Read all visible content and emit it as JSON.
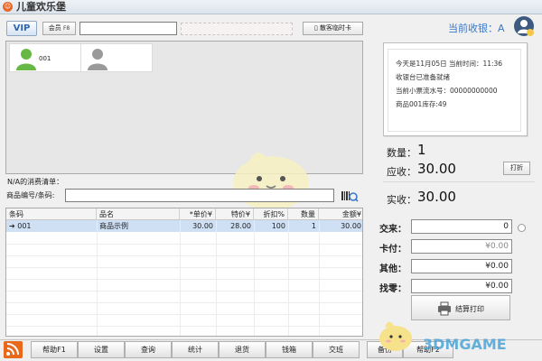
{
  "window": {
    "title": "儿童欢乐堡"
  },
  "toolbar": {
    "vip_label": "VIP",
    "member_label": "会员",
    "member_key": "F8",
    "member_input_value": "",
    "temp_card_label": "散客临时卡"
  },
  "cashier_panel": {
    "tiles": [
      {
        "label": "001"
      },
      {
        "label": ""
      }
    ]
  },
  "list": {
    "title": "N/A的消费清单：",
    "code_label": "商品编号/条码:",
    "code_value": "",
    "columns": [
      "条码",
      "品名",
      "*单价¥",
      "特价¥",
      "折扣%",
      "数量",
      "金额¥"
    ],
    "rows": [
      {
        "code": "001",
        "name": "商品示例",
        "price": "30.00",
        "special": "28.00",
        "discount": "100",
        "qty": "1",
        "amount": "30.00"
      }
    ]
  },
  "bottom_nav": [
    "帮助F1",
    "设置",
    "查询",
    "统计",
    "退货",
    "钱箱",
    "交班",
    "备份",
    "帮助F2"
  ],
  "right": {
    "cashier": "当前收银：A",
    "ticket_lines": [
      "今天是11月05日 当前时间：11:36",
      "收银台已准备就绪",
      "当前小票流水号：00000000000",
      "商品001库存:49"
    ],
    "qty_label": "数量：",
    "qty_value": "1",
    "due_label": "应收：",
    "due_value": "30.00",
    "discount_btn": "打折",
    "received_label": "实收：",
    "received_value": "30.00",
    "payments": [
      {
        "label": "交来：",
        "value": "0"
      },
      {
        "label": "卡付：",
        "value": "¥0.00"
      },
      {
        "label": "其他：",
        "value": "¥0.00"
      },
      {
        "label": "找零：",
        "value": "¥0.00"
      }
    ],
    "settle_label": "结算打印"
  },
  "watermark": "3DMGAME",
  "colors": {
    "accent": "#3a78c8",
    "selected_row": "#cfe0f5",
    "rss": "#e8681c"
  }
}
